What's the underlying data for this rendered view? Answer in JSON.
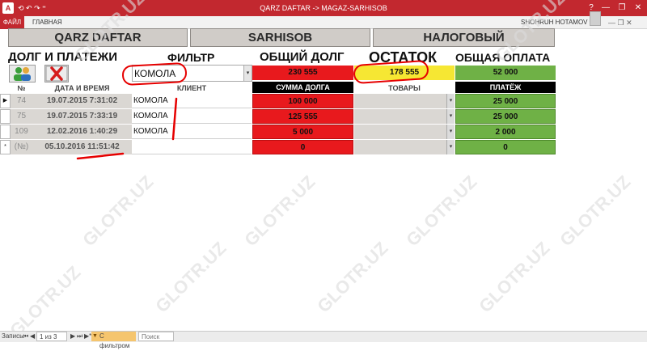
{
  "window": {
    "title": "QARZ DAFTAR -> MAGAZ-SARHISOB",
    "app_icon": "A",
    "qat": "⟲ ↶ ↷ ⁼",
    "controls": [
      "?",
      "—",
      "❐",
      "✕"
    ]
  },
  "ribbon": {
    "file_tab": "ФАЙЛ",
    "home_tab": "ГЛАВНАЯ",
    "user": "SHOHRUH HOTAMOV ▾",
    "right_buttons": "— ❐ ✕"
  },
  "nav": {
    "tab1": "QARZ DAFTAR",
    "tab2": "SARHISOB",
    "tab3": "НАЛОГОВЫЙ"
  },
  "headings": {
    "debts_payments": "ДОЛГ И ПЛАТЕЖИ",
    "filter": "ФИЛЬТР",
    "total_debt": "ОБЩИЙ ДОЛГ",
    "balance": "ОСТАТОК",
    "total_payment": "ОБЩАЯ ОПЛАТА"
  },
  "summary": {
    "filter_value": "КОМОЛА",
    "total_debt": "230 555",
    "balance": "178 555",
    "total_payment": "52 000"
  },
  "columns": {
    "num": "№",
    "datetime": "ДАТА И ВРЕМЯ",
    "client": "КЛИЕНТ",
    "debt_sum": "СУММА ДОЛГА",
    "goods": "ТОВАРЫ",
    "payment": "ПЛАТЁЖ"
  },
  "rows": [
    {
      "selector": "▶",
      "num": "74",
      "datetime": "19.07.2015 7:31:02",
      "client": "КОМОЛА",
      "debt": "100 000",
      "payment": "25 000"
    },
    {
      "selector": "",
      "num": "75",
      "datetime": "19.07.2015 7:33:19",
      "client": "КОМОЛА",
      "debt": "125 555",
      "payment": "25 000"
    },
    {
      "selector": "",
      "num": "109",
      "datetime": "12.02.2016 1:40:29",
      "client": "КОМОЛА",
      "debt": "5 000",
      "payment": "2 000"
    },
    {
      "selector": "*",
      "num": "(№)",
      "datetime": "05.10.2016 11:51:42",
      "client": "",
      "debt": "0",
      "payment": "0"
    }
  ],
  "watermark": "GLOTR.UZ",
  "statusbar": {
    "records_label": "Запись:",
    "first": "⏮",
    "prev": "◀",
    "position": "1 из 3",
    "next": "▶",
    "last": "⏭",
    "new": "▶*",
    "filter_badge": "С фильтром",
    "search_placeholder": "Поиск"
  },
  "colors": {
    "title_red": "#c2282f",
    "debt_red": "#e8191d",
    "balance_yellow": "#f6e733",
    "payment_green": "#6fb146",
    "header_black": "#000000"
  }
}
